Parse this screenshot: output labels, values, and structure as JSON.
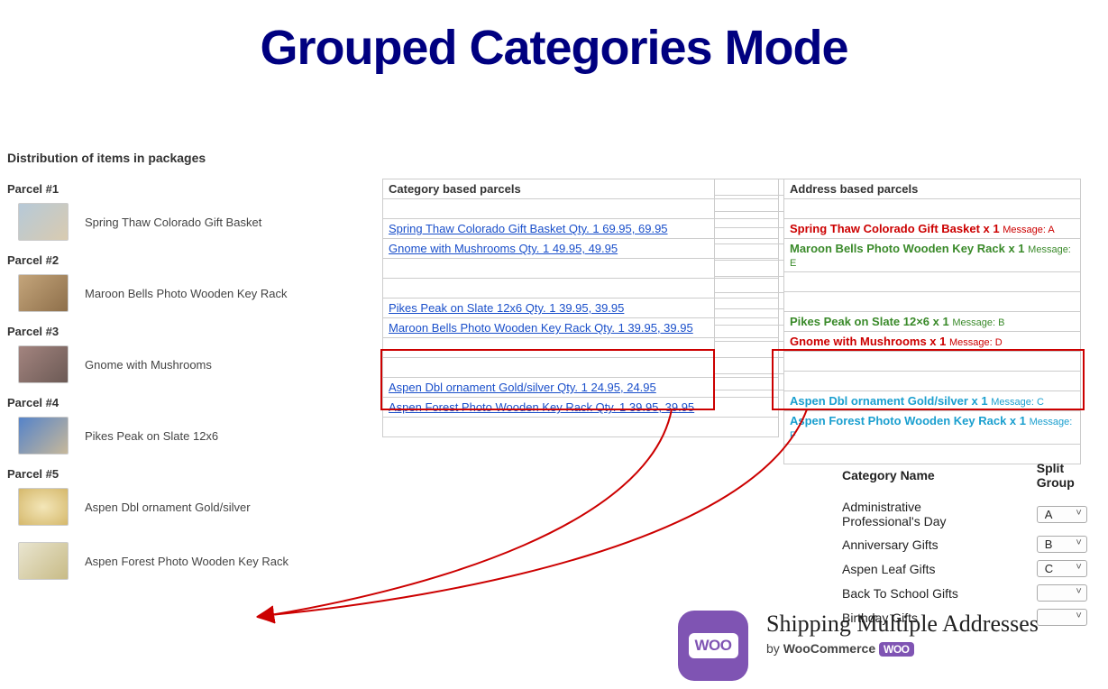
{
  "title": "Grouped Categories Mode",
  "dist_heading": "Distribution of items in packages",
  "parcels": [
    {
      "label": "Parcel #1",
      "item": "Spring Thaw Colorado Gift Basket"
    },
    {
      "label": "Parcel #2",
      "item": "Maroon Bells Photo Wooden Key Rack"
    },
    {
      "label": "Parcel #3",
      "item": "Gnome with Mushrooms"
    },
    {
      "label": "Parcel #4",
      "item": "Pikes Peak on Slate 12x6"
    },
    {
      "label": "Parcel #5",
      "item": "Aspen Dbl ornament Gold/silver"
    }
  ],
  "parcel5_extra": "Aspen Forest Photo Wooden Key Rack",
  "category_table": {
    "header": "Category based parcels",
    "groups": [
      [
        "Spring Thaw Colorado Gift Basket Qty. 1 69.95, 69.95",
        "Gnome with Mushrooms Qty. 1 49.95, 49.95"
      ],
      [
        "Pikes Peak on Slate 12x6 Qty. 1 39.95, 39.95",
        "Maroon Bells Photo Wooden Key Rack Qty. 1 39.95, 39.95"
      ],
      [
        "Aspen Dbl ornament Gold/silver Qty. 1 24.95, 24.95",
        "Aspen Forest Photo Wooden Key Rack Qty. 1 39.95, 39.95"
      ]
    ]
  },
  "address_table": {
    "header": "Address based parcels",
    "groups": [
      [
        {
          "text": "Spring Thaw Colorado Gift Basket x 1",
          "msg": "Message: A",
          "color": "red"
        },
        {
          "text": "Maroon Bells Photo Wooden Key Rack x 1",
          "msg": "Message: E",
          "color": "green"
        }
      ],
      [
        {
          "text": "Pikes Peak on Slate 12×6 x 1",
          "msg": "Message: B",
          "color": "green"
        },
        {
          "text": "Gnome with Mushrooms x 1",
          "msg": "Message: D",
          "color": "red"
        }
      ],
      [
        {
          "text": "Aspen Dbl ornament Gold/silver x 1",
          "msg": "Message: C",
          "color": "blue"
        },
        {
          "text": "Aspen Forest Photo Wooden Key Rack x 1",
          "msg": "Message: F",
          "color": "blue"
        }
      ]
    ]
  },
  "split_table": {
    "col1": "Category Name",
    "col2": "Split Group",
    "rows": [
      {
        "name": "Administrative Professional's Day",
        "val": "A"
      },
      {
        "name": "Anniversary Gifts",
        "val": "B"
      },
      {
        "name": "Aspen Leaf Gifts",
        "val": "C"
      },
      {
        "name": "Back To School Gifts",
        "val": ""
      },
      {
        "name": "Birthday Gifts",
        "val": ""
      }
    ]
  },
  "plugin": {
    "title": "Shipping Multiple Addresses",
    "by_prefix": "by ",
    "by": "WooCommerce",
    "woo": "WOO"
  }
}
